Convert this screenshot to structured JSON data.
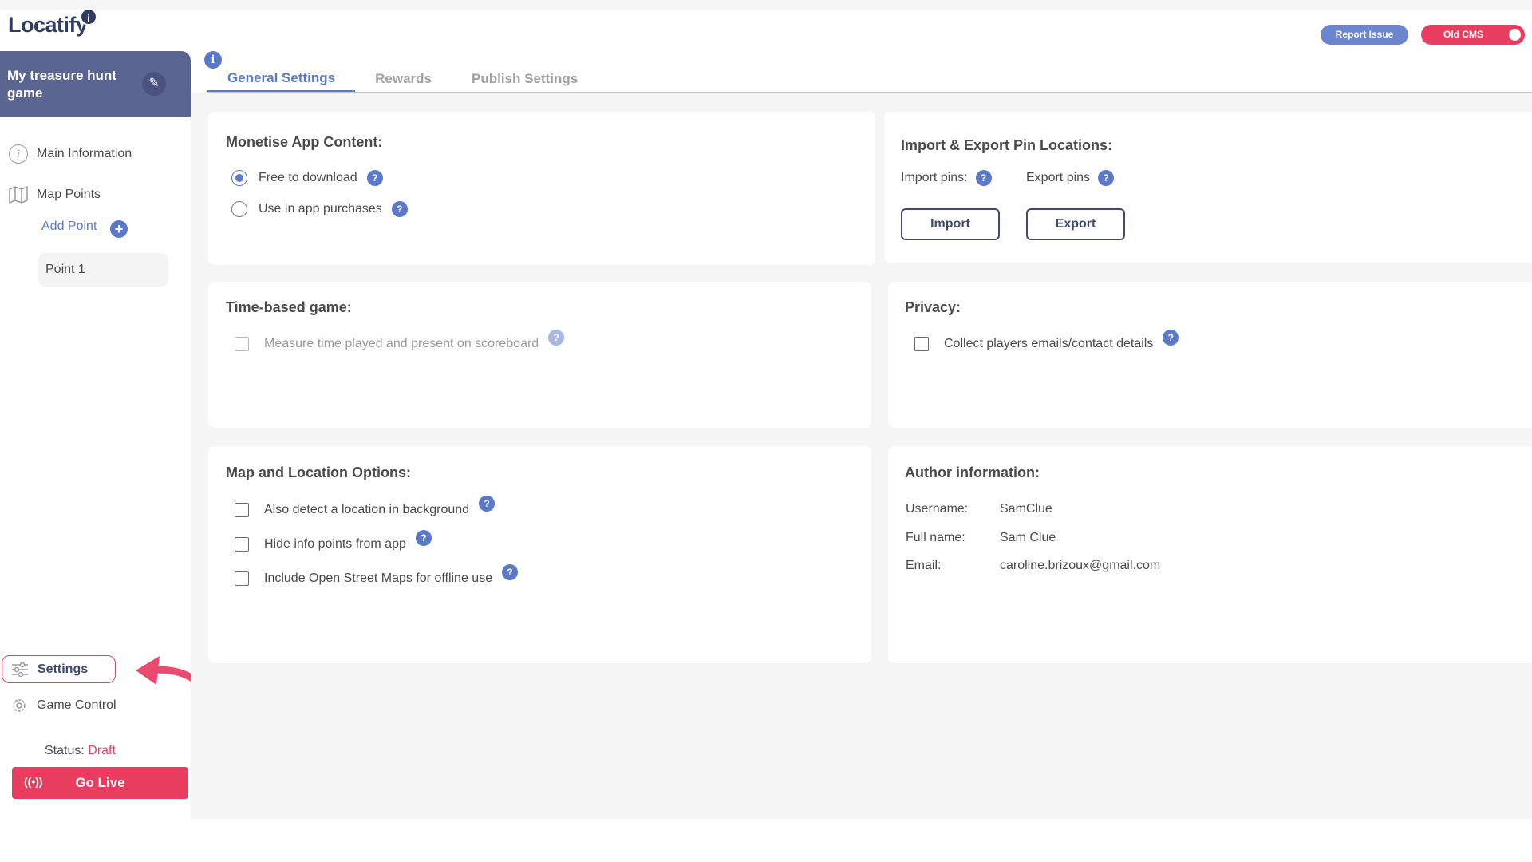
{
  "app": {
    "logo_text": "Locatify",
    "logo_badge": "i"
  },
  "header": {
    "report_issue": "Report Issue",
    "old_cms": "Old CMS"
  },
  "sidebar": {
    "game_title": "My treasure hunt game",
    "main_information": "Main Information",
    "map_points": "Map Points",
    "add_point": "Add Point",
    "point_1": "Point 1",
    "settings": "Settings",
    "game_control": "Game Control",
    "status_label": "Status:",
    "status_value": "Draft",
    "go_live": "Go Live"
  },
  "tabs": {
    "general": "General Settings",
    "rewards": "Rewards",
    "publish": "Publish Settings"
  },
  "monetise": {
    "title": "Monetise App Content:",
    "free": "Free to download",
    "in_app": "Use in app purchases",
    "selected": "Free to download"
  },
  "import_export": {
    "title": "Import & Export Pin Locations:",
    "import_label": "Import pins:",
    "export_label": "Export pins",
    "import_btn": "Import",
    "export_btn": "Export"
  },
  "time_based": {
    "title": "Time-based game:",
    "measure": "Measure time played and present on scoreboard"
  },
  "privacy": {
    "title": "Privacy:",
    "collect": "Collect players emails/contact details"
  },
  "map_options": {
    "title": "Map and Location Options:",
    "background": "Also detect a location in background",
    "hide_info": "Hide info points from app",
    "osm": "Include Open Street Maps for offline use"
  },
  "author": {
    "title": "Author information:",
    "username_label": "Username:",
    "username": "SamClue",
    "fullname_label": "Full name:",
    "fullname": "Sam Clue",
    "email_label": "Email:",
    "email": "caroline.brizoux@gmail.com"
  },
  "help_glyph": "?",
  "colors": {
    "accent": "#5b79c8",
    "sidebar_header": "#5b6592",
    "danger": "#e83d5f"
  }
}
